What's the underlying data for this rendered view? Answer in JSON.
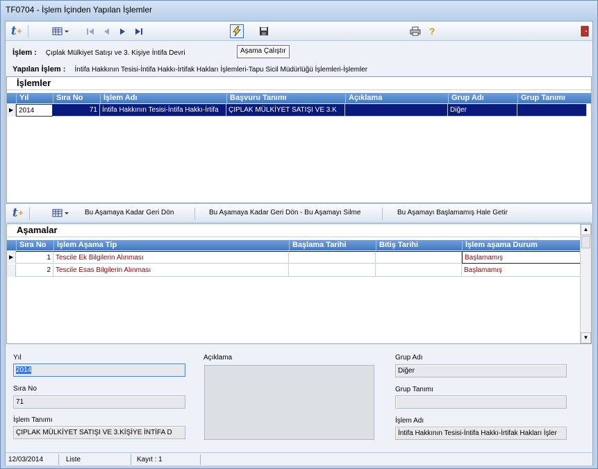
{
  "window": {
    "title": "TF0704 - İşlem İçinden Yapılan İşlemler"
  },
  "toolbar": {
    "logo_text": "t",
    "tooltip": "Aşama Çalıştır"
  },
  "info": {
    "islem_label": "İşlem :",
    "islem_value": "Çıplak Mülkiyet Satışı ve 3. Kişiye İntifa Devri",
    "yapilan_label": "Yapılan İşlem :",
    "yapilan_value": "İntifa Hakkının Tesisi-İntifa Hakkı-İrtifak Hakları İşlemleri-Tapu Sicil Müdürlüğü İşlemleri-İşlemler"
  },
  "islemler": {
    "caption": "İşlemler",
    "columns": [
      "Yıl",
      "Sıra No",
      "İşlem Adı",
      "Başvuru Tanımı",
      "Açıklama",
      "Grup Adı",
      "Grup Tanımı"
    ],
    "rows": [
      {
        "yil": "2014",
        "sira_no": "71",
        "islem_adi": "İntifa Hakkının Tesisi-İntifa Hakkı-İrtifa",
        "basvuru": "ÇIPLAK MÜLKİYET SATIŞI VE 3.K",
        "aciklama": "",
        "grup_adi": "Diğer",
        "grup_tanimi": ""
      }
    ]
  },
  "actions": {
    "geri_don": "Bu Aşamaya Kadar Geri Dön",
    "geri_don_sil": "Bu Aşamaya Kadar Geri Dön - Bu Aşamayı Silme",
    "baslamamis": "Bu Aşamayı Başlamamış Hale Getir"
  },
  "asamalar": {
    "caption": "Aşamalar",
    "columns": [
      "Sıra No",
      "İşlem Aşama Tip",
      "Başlama Tarihi",
      "Bitiş Tarihi",
      "İşlem aşama Durum"
    ],
    "rows": [
      {
        "sira_no": "1",
        "tip": "Tescile Ek Bilgilerin Alınması",
        "baslama": "",
        "bitis": "",
        "durum": "Başlamamış"
      },
      {
        "sira_no": "2",
        "tip": "Tescile Esas Bilgilerin Alınması",
        "baslama": "",
        "bitis": "",
        "durum": "Başlamamış"
      }
    ]
  },
  "detail": {
    "yil_label": "Yıl",
    "yil_value": "2014",
    "sira_no_label": "Sıra No",
    "sira_no_value": "71",
    "islem_tanimi_label": "İşlem Tanımı",
    "islem_tanimi_value": "ÇIPLAK MÜLKİYET SATIŞI VE 3.KİŞİYE İNTİFA D",
    "aciklama_label": "Açıklama",
    "grup_adi_label": "Grup Adı",
    "grup_adi_value": "Diğer",
    "grup_tanimi_label": "Grup Tanımı",
    "grup_tanimi_value": "",
    "islem_adi_label": "İşlem Adı",
    "islem_adi_value": "İntifa Hakkının Tesisi-İntifa Hakkı-İrtifak Hakları İşler"
  },
  "status": {
    "date": "12/03/2014",
    "mode": "Liste",
    "kayit": "Kayıt : 1"
  },
  "colors": {
    "selection": "#0a1a7a",
    "header": "#4479c1",
    "durum_text": "#8b0000"
  }
}
